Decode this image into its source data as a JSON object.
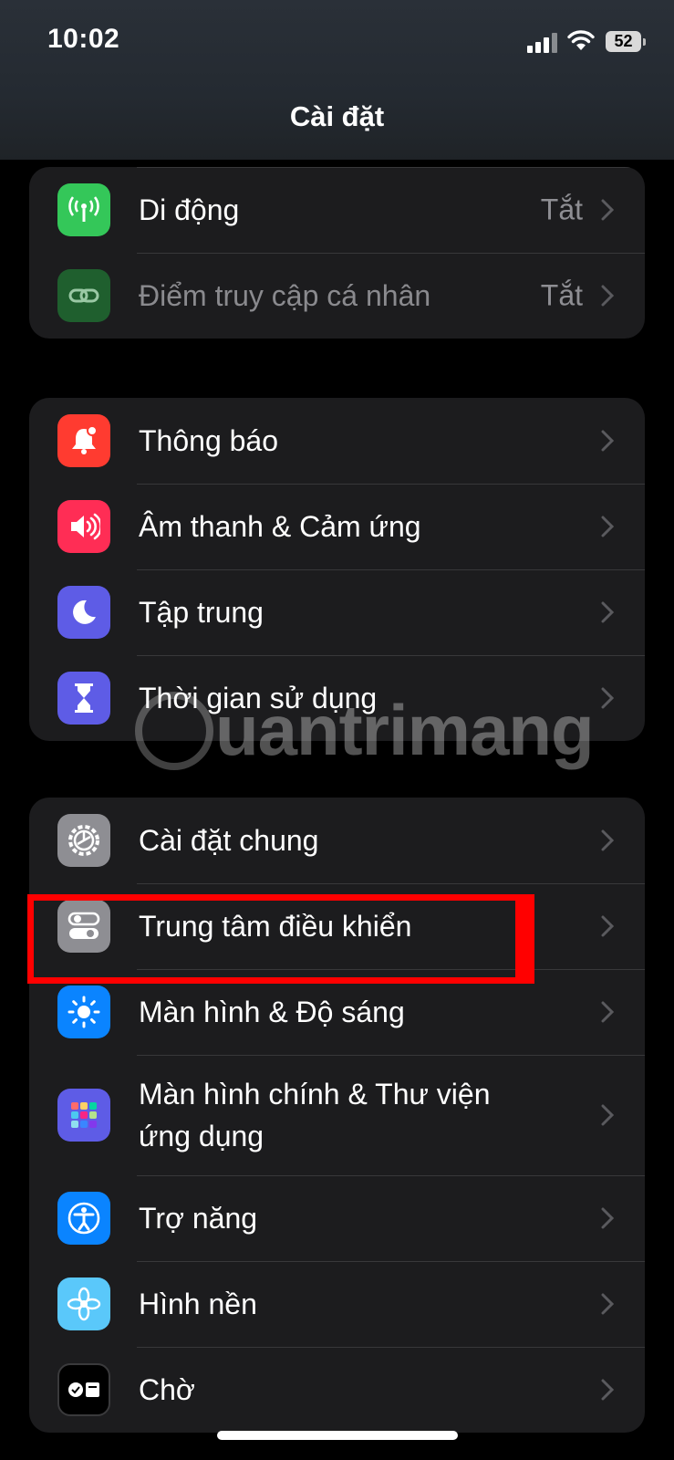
{
  "status": {
    "time": "10:02",
    "battery": "52"
  },
  "header": {
    "title": "Cài đặt"
  },
  "group1": [
    {
      "label": "Di động",
      "value": "Tắt",
      "icon": "cellular-icon"
    },
    {
      "label": "Điểm truy cập cá nhân",
      "value": "Tắt",
      "icon": "hotspot-icon"
    }
  ],
  "group2": [
    {
      "label": "Thông báo",
      "icon": "bell-icon"
    },
    {
      "label": "Âm thanh & Cảm ứng",
      "icon": "speaker-icon"
    },
    {
      "label": "Tập trung",
      "icon": "moon-icon"
    },
    {
      "label": "Thời gian sử dụng",
      "icon": "hourglass-icon"
    }
  ],
  "group3": [
    {
      "label": "Cài đặt chung",
      "icon": "gear-icon"
    },
    {
      "label": "Trung tâm điều khiển",
      "icon": "toggles-icon"
    },
    {
      "label": "Màn hình & Độ sáng",
      "icon": "sun-icon"
    },
    {
      "label": "Màn hình chính & Thư viện ứng dụng",
      "icon": "app-grid-icon"
    },
    {
      "label": "Trợ năng",
      "icon": "accessibility-icon"
    },
    {
      "label": "Hình nền",
      "icon": "flower-icon"
    },
    {
      "label": "Chờ",
      "icon": "standby-icon"
    }
  ],
  "watermark": "uantrimang",
  "colors": {
    "green": "#34c759",
    "red": "#ff3b30",
    "pink": "#ff2d55",
    "indigo": "#5e5ce6",
    "gray": "#8e8e93",
    "blue": "#0a84ff",
    "cyan": "#5ac8fa",
    "highlight": "#ff0000"
  }
}
